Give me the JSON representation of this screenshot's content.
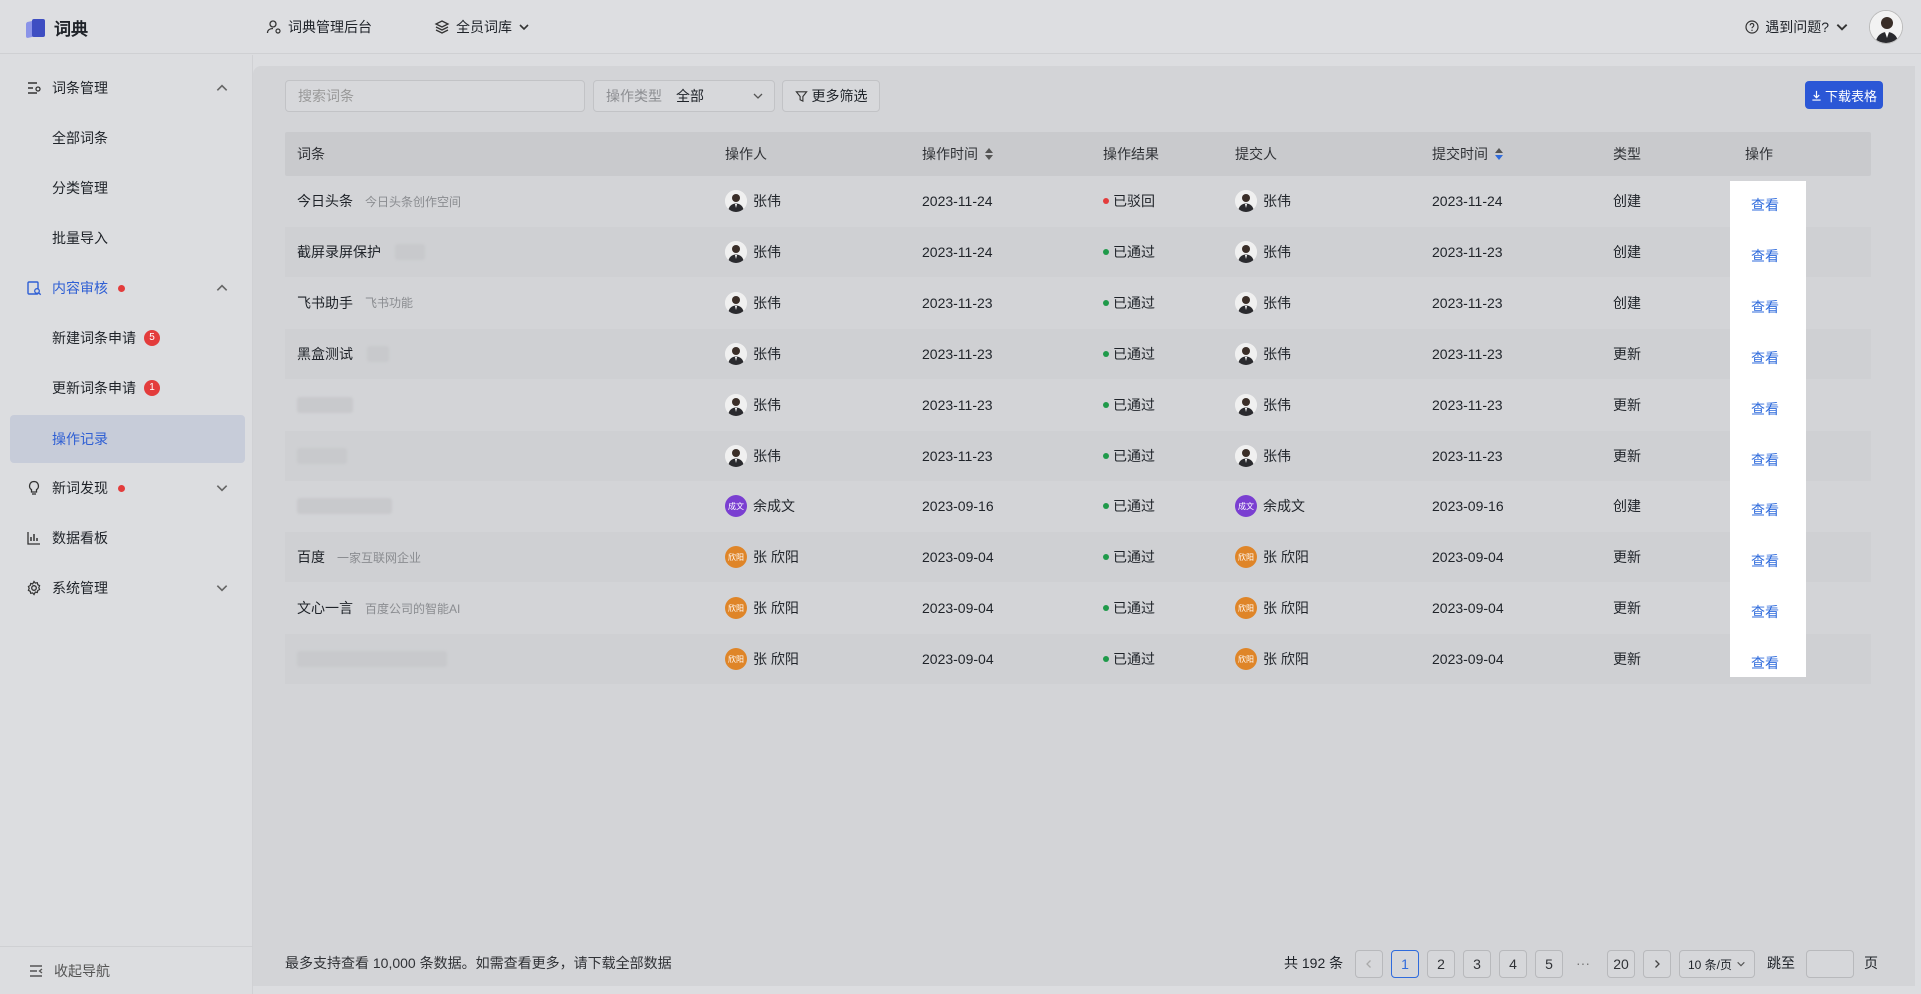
{
  "header": {
    "app_name": "词典",
    "admin_label": "词典管理后台",
    "library_label": "全员词库",
    "help_label": "遇到问题?"
  },
  "sidebar": {
    "groups": [
      {
        "label": "词条管理",
        "items": [
          "全部词条",
          "分类管理",
          "批量导入"
        ]
      },
      {
        "label": "内容审核",
        "items": [
          "新建词条申请",
          "更新词条申请",
          "操作记录"
        ],
        "badges": [
          "5",
          "1"
        ]
      },
      {
        "label": "新词发现"
      },
      {
        "label": "数据看板"
      },
      {
        "label": "系统管理"
      }
    ],
    "collapse_label": "收起导航"
  },
  "filters": {
    "search_placeholder": "搜索词条",
    "op_type_label": "操作类型",
    "op_type_value": "全部",
    "more_filter_label": "更多筛选",
    "download_label": "下载表格"
  },
  "table": {
    "headers": [
      "词条",
      "操作人",
      "操作时间",
      "操作结果",
      "提交人",
      "提交时间",
      "类型",
      "操作"
    ],
    "rows": [
      {
        "term": "今日头条",
        "desc": "今日头条创作空间",
        "operator": "张伟",
        "op_time": "2023-11-24",
        "result": "已驳回",
        "submitter": "张伟",
        "sub_time": "2023-11-24",
        "type": "创建",
        "action": "查看"
      },
      {
        "term": "截屏录屏保护",
        "desc": "",
        "operator": "张伟",
        "op_time": "2023-11-24",
        "result": "已通过",
        "submitter": "张伟",
        "sub_time": "2023-11-23",
        "type": "创建",
        "action": "查看"
      },
      {
        "term": "飞书助手",
        "desc": "飞书功能",
        "operator": "张伟",
        "op_time": "2023-11-23",
        "result": "已通过",
        "submitter": "张伟",
        "sub_time": "2023-11-23",
        "type": "创建",
        "action": "查看"
      },
      {
        "term": "黑盒测试",
        "desc": "",
        "operator": "张伟",
        "op_time": "2023-11-23",
        "result": "已通过",
        "submitter": "张伟",
        "sub_time": "2023-11-23",
        "type": "更新",
        "action": "查看"
      },
      {
        "term": "",
        "desc": "",
        "operator": "张伟",
        "op_time": "2023-11-23",
        "result": "已通过",
        "submitter": "张伟",
        "sub_time": "2023-11-23",
        "type": "更新",
        "action": "查看"
      },
      {
        "term": "",
        "desc": "",
        "operator": "张伟",
        "op_time": "2023-11-23",
        "result": "已通过",
        "submitter": "张伟",
        "sub_time": "2023-11-23",
        "type": "更新",
        "action": "查看"
      },
      {
        "term": "",
        "desc": "",
        "operator": "余成文",
        "operator_initials": "成文",
        "op_time": "2023-09-16",
        "result": "已通过",
        "submitter": "余成文",
        "submitter_initials": "成文",
        "sub_time": "2023-09-16",
        "type": "创建",
        "action": "查看"
      },
      {
        "term": "百度",
        "desc": "一家互联网企业",
        "operator": "张 欣阳",
        "operator_initials": "欣阳",
        "op_time": "2023-09-04",
        "result": "已通过",
        "submitter": "张 欣阳",
        "submitter_initials": "欣阳",
        "sub_time": "2023-09-04",
        "type": "更新",
        "action": "查看"
      },
      {
        "term": "文心一言",
        "desc": "百度公司的智能AI",
        "operator": "张 欣阳",
        "operator_initials": "欣阳",
        "op_time": "2023-09-04",
        "result": "已通过",
        "submitter": "张 欣阳",
        "submitter_initials": "欣阳",
        "sub_time": "2023-09-04",
        "type": "更新",
        "action": "查看"
      },
      {
        "term": "",
        "desc": "",
        "operator": "张 欣阳",
        "operator_initials": "欣阳",
        "op_time": "2023-09-04",
        "result": "已通过",
        "submitter": "张 欣阳",
        "submitter_initials": "欣阳",
        "sub_time": "2023-09-04",
        "type": "更新",
        "action": "查看"
      }
    ]
  },
  "footer": {
    "note": "最多支持查看 10,000 条数据。如需查看更多，请下载全部数据",
    "total": "共 192 条",
    "pages": [
      "1",
      "2",
      "3",
      "4",
      "5"
    ],
    "ellipsis": "···",
    "last_page": "20",
    "page_size": "10 条/页",
    "jump_label": "跳至",
    "jump_suffix": "页"
  },
  "colors": {
    "accent": "#2f6bdc",
    "rejected": "#e33c3c",
    "approved": "#1f9a4a"
  }
}
